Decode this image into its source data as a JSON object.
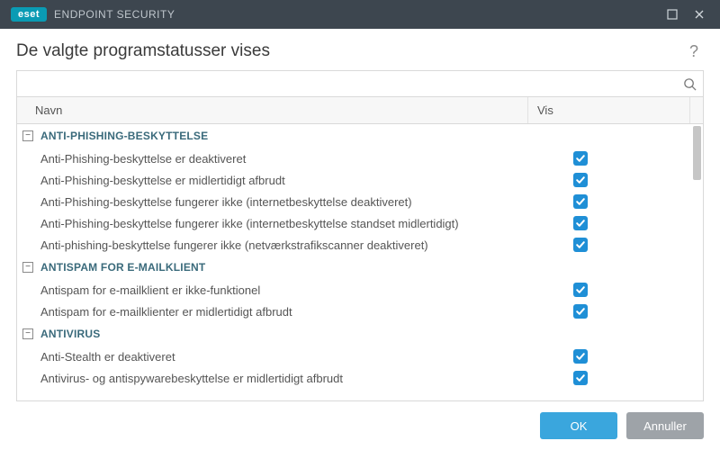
{
  "brand": {
    "badge": "eset",
    "product": "ENDPOINT SECURITY"
  },
  "page": {
    "title": "De valgte programstatusser vises",
    "help_label": "?"
  },
  "search": {
    "placeholder": ""
  },
  "columns": {
    "name": "Navn",
    "vis": "Vis"
  },
  "groups": [
    {
      "label": "ANTI-PHISHING-BESKYTTELSE",
      "items": [
        {
          "label": "Anti-Phishing-beskyttelse er deaktiveret",
          "checked": true
        },
        {
          "label": "Anti-Phishing-beskyttelse er midlertidigt afbrudt",
          "checked": true
        },
        {
          "label": "Anti-Phishing-beskyttelse fungerer ikke (internetbeskyttelse deaktiveret)",
          "checked": true
        },
        {
          "label": "Anti-Phishing-beskyttelse fungerer ikke (internetbeskyttelse standset midlertidigt)",
          "checked": true
        },
        {
          "label": "Anti-phishing-beskyttelse fungerer ikke (netværkstrafikscanner deaktiveret)",
          "checked": true
        }
      ]
    },
    {
      "label": "ANTISPAM FOR E-MAILKLIENT",
      "items": [
        {
          "label": "Antispam for e-mailklient er ikke-funktionel",
          "checked": true
        },
        {
          "label": "Antispam for e-mailklienter er midlertidigt afbrudt",
          "checked": true
        }
      ]
    },
    {
      "label": "ANTIVIRUS",
      "items": [
        {
          "label": "Anti-Stealth er deaktiveret",
          "checked": true
        },
        {
          "label": "Antivirus- og antispywarebeskyttelse er midlertidigt afbrudt",
          "checked": true
        }
      ]
    }
  ],
  "footer": {
    "ok": "OK",
    "cancel": "Annuller"
  },
  "colors": {
    "accent": "#1f8fd6",
    "titlebar": "#3d464f",
    "brand": "#0a9bb4"
  }
}
